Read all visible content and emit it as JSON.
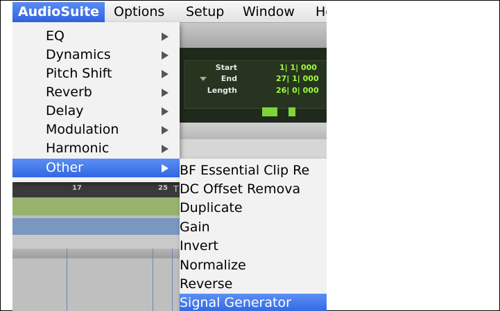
{
  "menubar": {
    "items": [
      "AudioSuite",
      "Options",
      "Setup",
      "Window",
      "He"
    ]
  },
  "audiosuite_menu": {
    "items": [
      "EQ",
      "Dynamics",
      "Pitch Shift",
      "Reverb",
      "Delay",
      "Modulation",
      "Harmonic",
      "Other"
    ]
  },
  "other_submenu": {
    "items": [
      "BF Essential Clip Re",
      "DC Offset Remova",
      "Duplicate",
      "Gain",
      "Invert",
      "Normalize",
      "Reverse",
      "Signal Generator"
    ]
  },
  "counter": {
    "labels": [
      "Start",
      "End",
      "Length"
    ],
    "values": [
      "1| 1| 000",
      "27| 1| 000",
      "26| 0| 000"
    ]
  },
  "ruler": {
    "marks": [
      "17",
      "25"
    ],
    "cursor_glyph": "T"
  },
  "colors": {
    "highlight": "#3067e2",
    "counter_value": "#9dff3a"
  }
}
